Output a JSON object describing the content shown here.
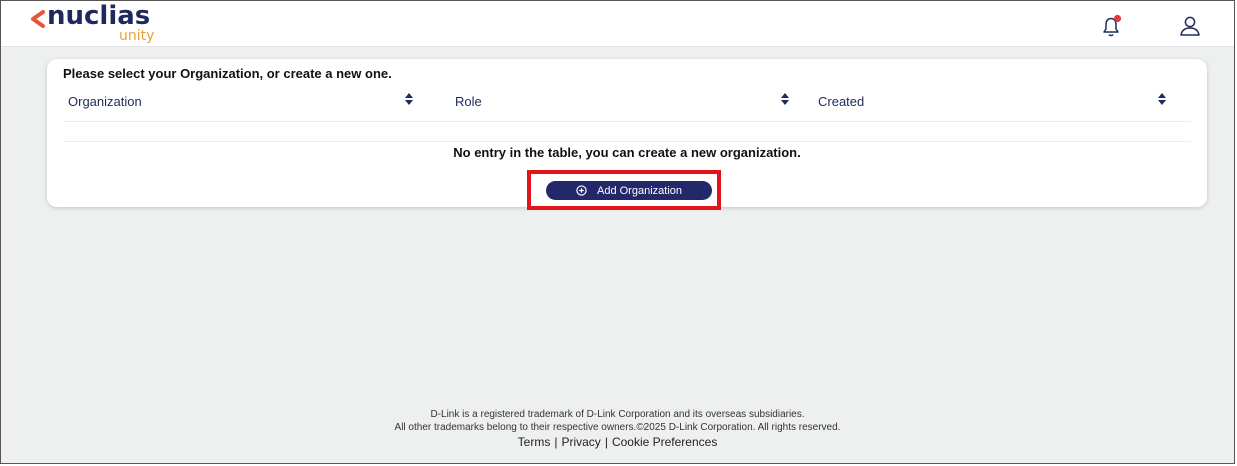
{
  "brand": {
    "name": "nuclias",
    "product": "unity",
    "primary_color": "#1f2a5c",
    "accent_color": "#e8a33d",
    "chevron_color": "#e8533a"
  },
  "header": {
    "icons": [
      "bell-icon",
      "user-icon"
    ],
    "notification_dot_color": "#e23a3a"
  },
  "card": {
    "title": "Please select your Organization, or create a new one.",
    "columns": [
      {
        "label": "Organization"
      },
      {
        "label": "Role"
      },
      {
        "label": "Created"
      }
    ],
    "empty_message": "No entry in the table, you can create a new organization.",
    "add_button_label": "Add Organization",
    "add_button_icon": "plus-circle-icon",
    "highlight_color": "#e4141b"
  },
  "footer": {
    "line1": "D-Link is a registered trademark of D-Link Corporation and its overseas subsidiaries.",
    "line2": "All other trademarks belong to their respective owners.©2025 D-Link Corporation. All rights reserved.",
    "links": {
      "terms": "Terms",
      "privacy": "Privacy",
      "cookies": "Cookie Preferences",
      "separator": "|"
    }
  }
}
